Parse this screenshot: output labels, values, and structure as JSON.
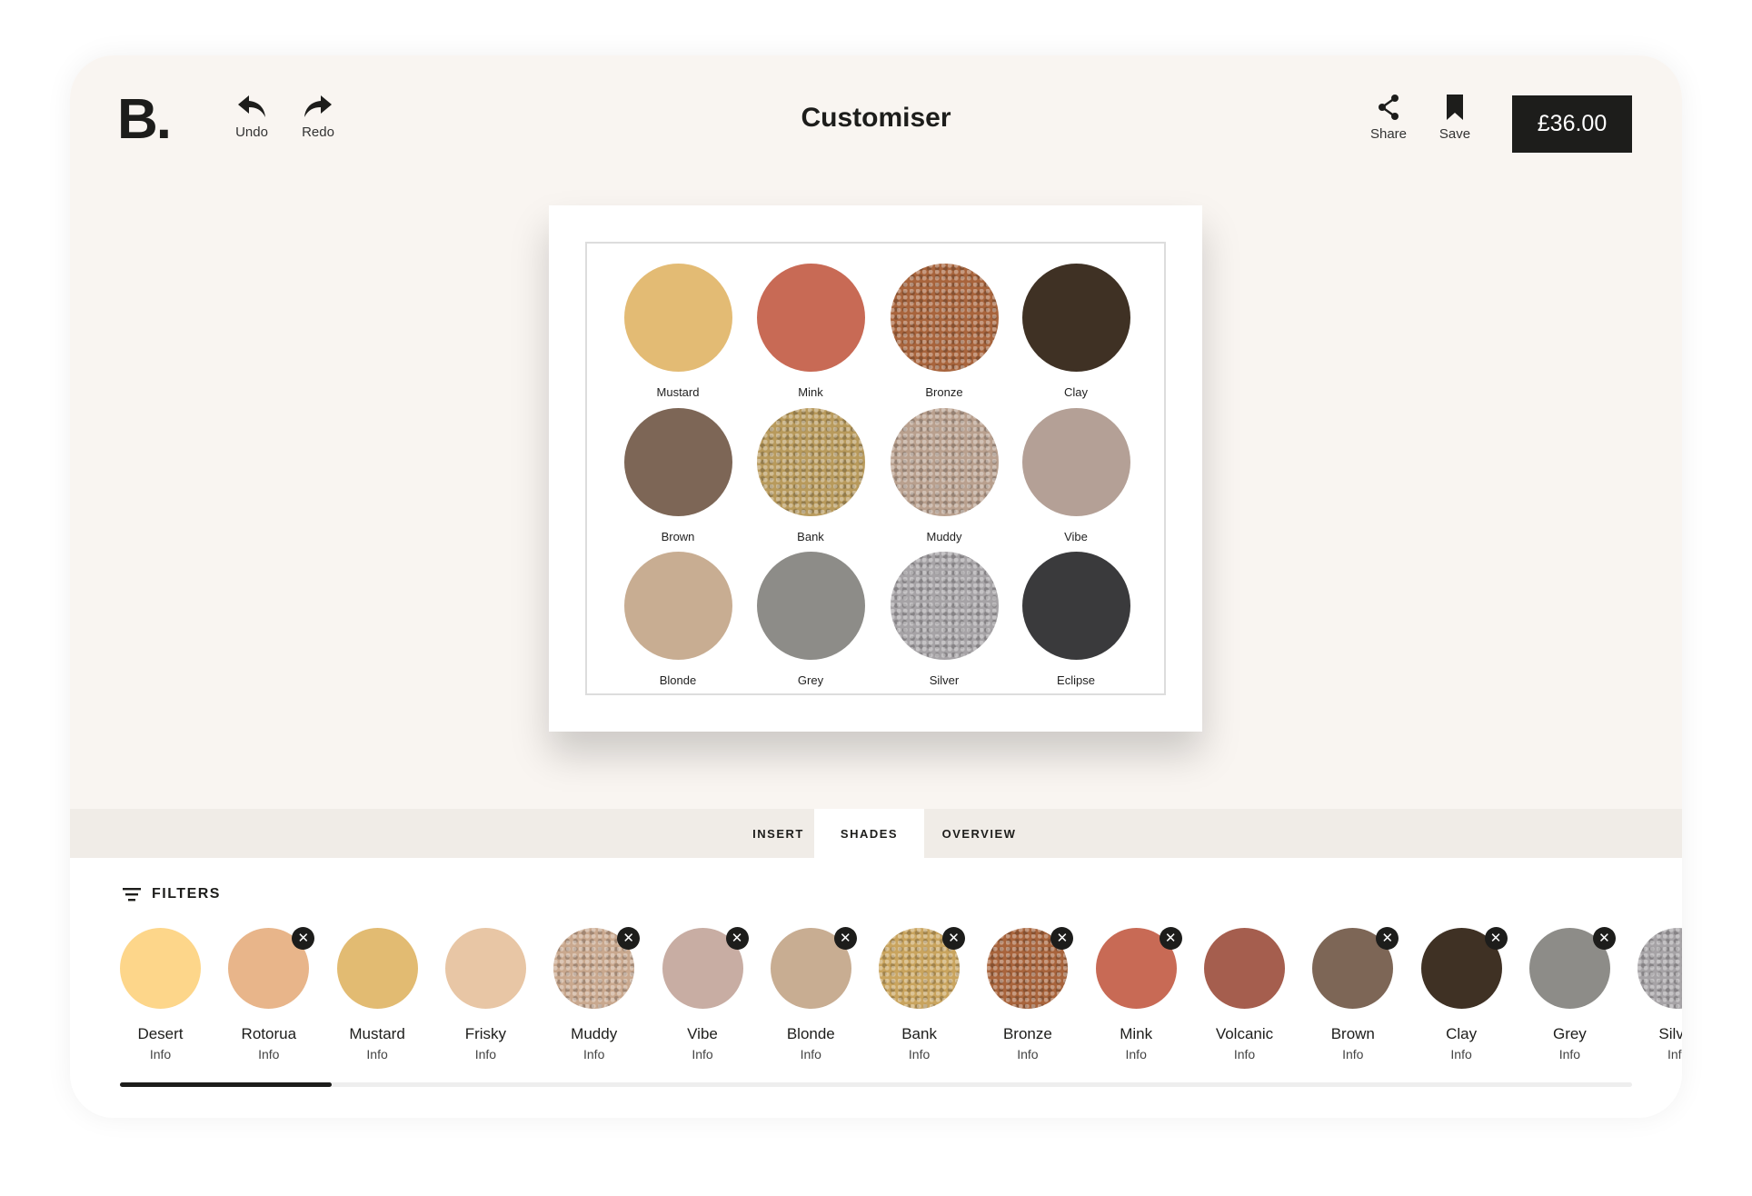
{
  "header": {
    "logo": "B.",
    "undo": "Undo",
    "redo": "Redo",
    "title": "Customiser",
    "share": "Share",
    "save": "Save",
    "price": "£36.00"
  },
  "palette": [
    {
      "name": "Mustard",
      "color": "#e3bb74",
      "glitter": false
    },
    {
      "name": "Mink",
      "color": "#c86a55",
      "glitter": false
    },
    {
      "name": "Bronze",
      "color": "#a8643c",
      "glitter": true
    },
    {
      "name": "Clay",
      "color": "#3f3124",
      "glitter": false
    },
    {
      "name": "Brown",
      "color": "#7d6656",
      "glitter": false
    },
    {
      "name": "Bank",
      "color": "#b89a5c",
      "glitter": true
    },
    {
      "name": "Muddy",
      "color": "#b9a08e",
      "glitter": true
    },
    {
      "name": "Vibe",
      "color": "#b4a096",
      "glitter": false
    },
    {
      "name": "Blonde",
      "color": "#c8ad92",
      "glitter": false
    },
    {
      "name": "Grey",
      "color": "#8d8c88",
      "glitter": false
    },
    {
      "name": "Silver",
      "color": "#a6a3a6",
      "glitter": true
    },
    {
      "name": "Eclipse",
      "color": "#3a3a3c",
      "glitter": false
    }
  ],
  "tabs": [
    {
      "label": "INSERT",
      "active": false
    },
    {
      "label": "SHADES",
      "active": true
    },
    {
      "label": "OVERVIEW",
      "active": false
    }
  ],
  "filters_label": "FILTERS",
  "shades": [
    {
      "name": "Desert",
      "info": "Info",
      "color": "#fdd68a",
      "selected": false,
      "glitter": false
    },
    {
      "name": "Rotorua",
      "info": "Info",
      "color": "#e8b58a",
      "selected": true,
      "glitter": false
    },
    {
      "name": "Mustard",
      "info": "Info",
      "color": "#e2bb72",
      "selected": false,
      "glitter": false
    },
    {
      "name": "Frisky",
      "info": "Info",
      "color": "#e8c6a5",
      "selected": false,
      "glitter": false
    },
    {
      "name": "Muddy",
      "info": "Info",
      "color": "#c9a88e",
      "selected": true,
      "glitter": true
    },
    {
      "name": "Vibe",
      "info": "Info",
      "color": "#c8ada3",
      "selected": true,
      "glitter": false
    },
    {
      "name": "Blonde",
      "info": "Info",
      "color": "#c8ad92",
      "selected": true,
      "glitter": false
    },
    {
      "name": "Bank",
      "info": "Info",
      "color": "#c9a45e",
      "selected": true,
      "glitter": true
    },
    {
      "name": "Bronze",
      "info": "Info",
      "color": "#a8643c",
      "selected": true,
      "glitter": true
    },
    {
      "name": "Mink",
      "info": "Info",
      "color": "#c86a55",
      "selected": true,
      "glitter": false
    },
    {
      "name": "Volcanic",
      "info": "Info",
      "color": "#a55e4e",
      "selected": false,
      "glitter": false
    },
    {
      "name": "Brown",
      "info": "Info",
      "color": "#7d6656",
      "selected": true,
      "glitter": false
    },
    {
      "name": "Clay",
      "info": "Info",
      "color": "#3f3124",
      "selected": true,
      "glitter": false
    },
    {
      "name": "Grey",
      "info": "Info",
      "color": "#8d8c88",
      "selected": true,
      "glitter": false
    },
    {
      "name": "Silver",
      "info": "Info",
      "color": "#a6a3a6",
      "selected": false,
      "glitter": true
    }
  ],
  "scroll_progress": 0.14
}
